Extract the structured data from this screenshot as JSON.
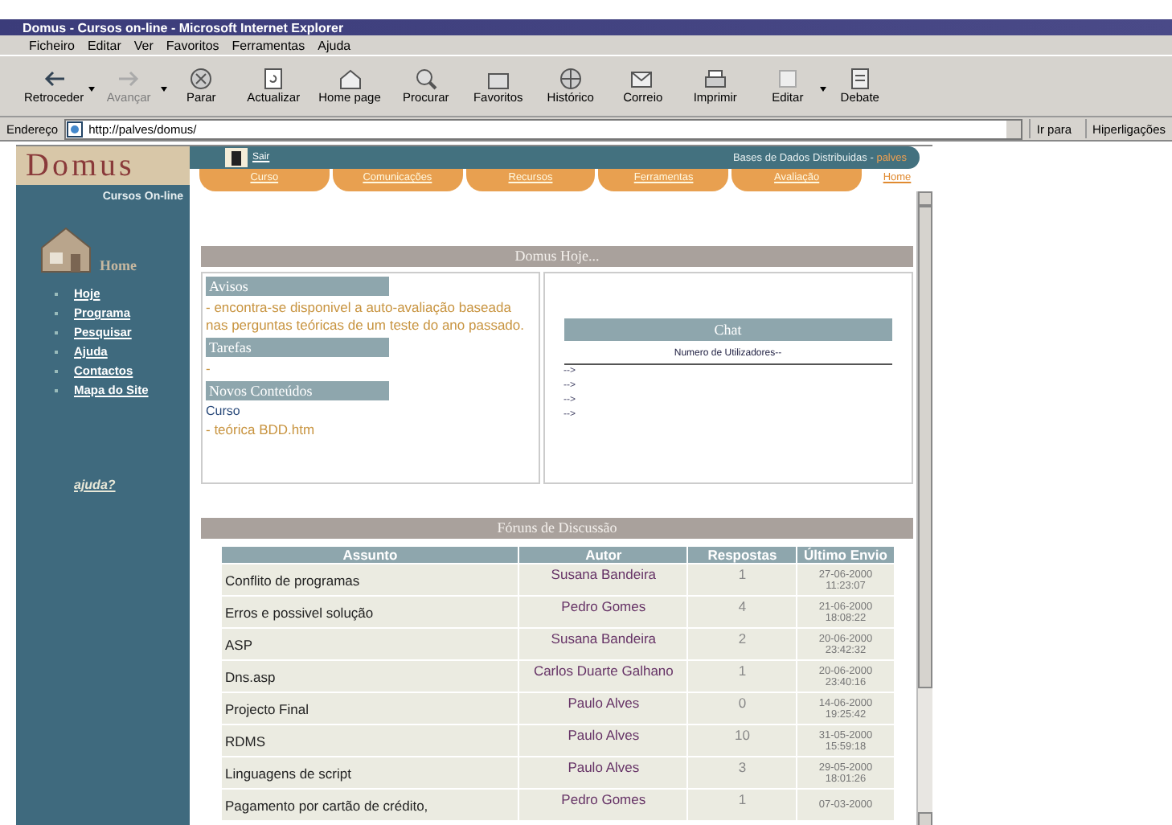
{
  "window": {
    "title": "Domus - Cursos on-line - Microsoft Internet Explorer"
  },
  "menu": [
    "Ficheiro",
    "Editar",
    "Ver",
    "Favoritos",
    "Ferramentas",
    "Ajuda"
  ],
  "toolbar": [
    {
      "label": "Retroceder",
      "disabled": false,
      "dropdown": true
    },
    {
      "label": "Avançar",
      "disabled": true,
      "dropdown": true
    },
    {
      "label": "Parar",
      "disabled": false,
      "dropdown": false
    },
    {
      "label": "Actualizar",
      "disabled": false,
      "dropdown": false
    },
    {
      "label": "Home page",
      "disabled": false,
      "dropdown": false
    },
    {
      "label": "Procurar",
      "disabled": false,
      "dropdown": false
    },
    {
      "label": "Favoritos",
      "disabled": false,
      "dropdown": false
    },
    {
      "label": "Histórico",
      "disabled": false,
      "dropdown": false
    },
    {
      "label": "Correio",
      "disabled": false,
      "dropdown": false
    },
    {
      "label": "Imprimir",
      "disabled": false,
      "dropdown": false
    },
    {
      "label": "Editar",
      "disabled": false,
      "dropdown": true
    },
    {
      "label": "Debate",
      "disabled": false,
      "dropdown": false
    }
  ],
  "address": {
    "label": "Endereço",
    "value": "http://palves/domus/",
    "go": "Ir para",
    "links": "Hiperligações"
  },
  "site": {
    "logo": "Domus",
    "subtitle": "Cursos On-line",
    "home": "Home",
    "help": "ajuda?",
    "exit": "Sair",
    "course": "Bases de Dados Distribuidas - ",
    "user": "palves",
    "nav": [
      "Hoje",
      "Programa",
      "Pesquisar",
      "Ajuda",
      "Contactos",
      "Mapa do Site"
    ],
    "tabs": [
      {
        "label": "Curso",
        "selected": false
      },
      {
        "label": "Comunicações",
        "selected": false
      },
      {
        "label": "Recursos",
        "selected": false
      },
      {
        "label": "Ferramentas",
        "selected": false
      },
      {
        "label": "Avaliação",
        "selected": false
      },
      {
        "label": "Home",
        "selected": true
      }
    ]
  },
  "today": {
    "title": "Domus Hoje...",
    "sections": [
      {
        "heading": "Avisos",
        "items": [
          {
            "text": "- encontra-se disponivel a auto-avaliação baseada nas perguntas teóricas de um teste do ano passado.",
            "kind": "note"
          }
        ]
      },
      {
        "heading": "Tarefas",
        "items": [
          {
            "text": "-",
            "kind": "note"
          }
        ]
      },
      {
        "heading": "Novos Conteúdos",
        "items": [
          {
            "text": "Curso",
            "kind": "link"
          },
          {
            "text": "- teórica BDD.htm",
            "kind": "note"
          }
        ]
      }
    ],
    "chat": {
      "title": "Chat",
      "users": "Numero de Utilizadores--",
      "lines": [
        "-->",
        "-->",
        "-->",
        "-->"
      ]
    }
  },
  "forum": {
    "title": "Fóruns de Discussão",
    "columns": [
      "Assunto",
      "Autor",
      "Respostas",
      "Último Envio"
    ],
    "rows": [
      [
        "Conflito de programas",
        "Susana Bandeira",
        "1",
        "27-06-2000 11:23:07"
      ],
      [
        "Erros e possivel solução",
        "Pedro Gomes",
        "4",
        "21-06-2000 18:08:22"
      ],
      [
        "ASP",
        "Susana Bandeira",
        "2",
        "20-06-2000 23:42:32"
      ],
      [
        "Dns.asp",
        "Carlos Duarte Galhano",
        "1",
        "20-06-2000 23:40:16"
      ],
      [
        "Projecto Final",
        "Paulo Alves",
        "0",
        "14-06-2000 19:25:42"
      ],
      [
        "RDMS",
        "Paulo Alves",
        "10",
        "31-05-2000 15:59:18"
      ],
      [
        "Linguagens de script",
        "Paulo Alves",
        "3",
        "29-05-2000 18:01:26"
      ],
      [
        "Pagamento por cartão de crédito,",
        "Pedro Gomes",
        "1",
        "07-03-2000"
      ]
    ]
  }
}
